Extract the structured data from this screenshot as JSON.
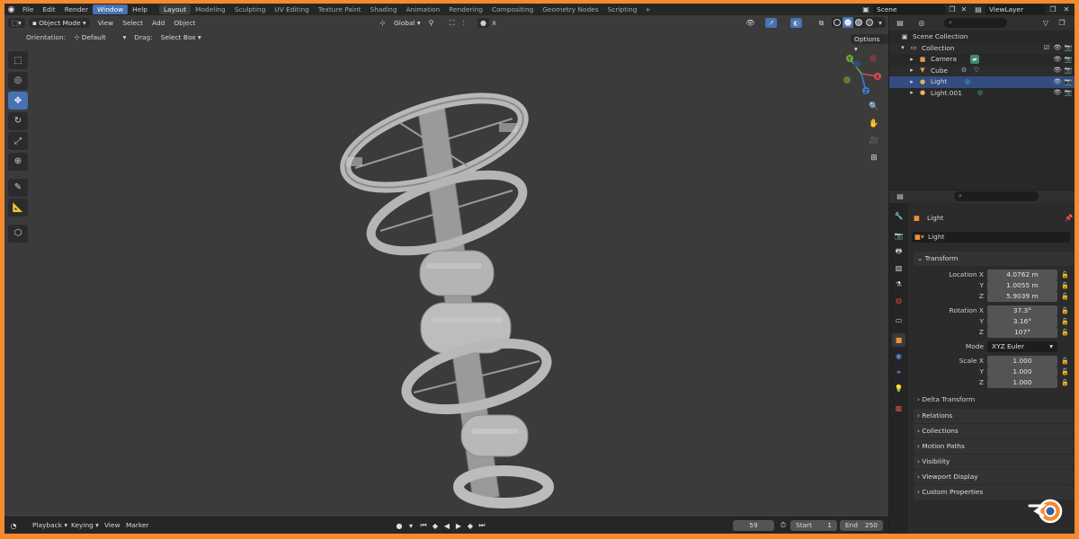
{
  "menus": {
    "file": "File",
    "edit": "Edit",
    "render": "Render",
    "window": "Window",
    "help": "Help"
  },
  "workspaces": [
    "Layout",
    "Modeling",
    "Sculpting",
    "UV Editing",
    "Texture Paint",
    "Shading",
    "Animation",
    "Rendering",
    "Compositing",
    "Geometry Nodes",
    "Scripting"
  ],
  "workspace_add": "+",
  "scene": "Scene",
  "view_layer": "ViewLayer",
  "viewport": {
    "mode": "Object Mode",
    "menus": [
      "View",
      "Select",
      "Add",
      "Object"
    ],
    "orientation_label": "Orientation:",
    "orientation_value": "Default",
    "drag_label": "Drag:",
    "drag_value": "Select Box",
    "transform_orientation": "Global",
    "options_label": "Options",
    "gizmo_axes": {
      "x": "X",
      "y": "Y",
      "z": "Z"
    }
  },
  "timeline": {
    "playback": "Playback",
    "keying": "Keying",
    "view": "View",
    "marker": "Marker",
    "current_frame": "59",
    "start_label": "Start",
    "start_value": "1",
    "end_label": "End",
    "end_value": "250"
  },
  "outliner": {
    "scene_collection": "Scene Collection",
    "collection": "Collection",
    "items": [
      {
        "name": "Camera",
        "selected": false
      },
      {
        "name": "Cube",
        "selected": false
      },
      {
        "name": "Light",
        "selected": true
      },
      {
        "name": "Light.001",
        "selected": false
      }
    ]
  },
  "properties": {
    "object_title": "Light",
    "object_name": "Light",
    "transform_header": "Transform",
    "location": {
      "label_x": "Location X",
      "label_y": "Y",
      "label_z": "Z",
      "x": "4.0762 m",
      "y": "1.0055 m",
      "z": "5.9039 m"
    },
    "rotation": {
      "label_x": "Rotation X",
      "label_y": "Y",
      "label_z": "Z",
      "x": "37.3°",
      "y": "3.16°",
      "z": "107°"
    },
    "mode_label": "Mode",
    "mode_value": "XYZ Euler",
    "scale": {
      "label_x": "Scale X",
      "label_y": "Y",
      "label_z": "Z",
      "x": "1.000",
      "y": "1.000",
      "z": "1.000"
    },
    "delta_transform": "Delta Transform",
    "panels": [
      "Relations",
      "Collections",
      "Motion Paths",
      "Visibility",
      "Viewport Display",
      "Custom Properties"
    ]
  },
  "colors": {
    "accent": "#4772b3",
    "frame_border": "#f58a2e",
    "viewport_bg": "#3b3b3b",
    "model": "#c2c2c2"
  }
}
